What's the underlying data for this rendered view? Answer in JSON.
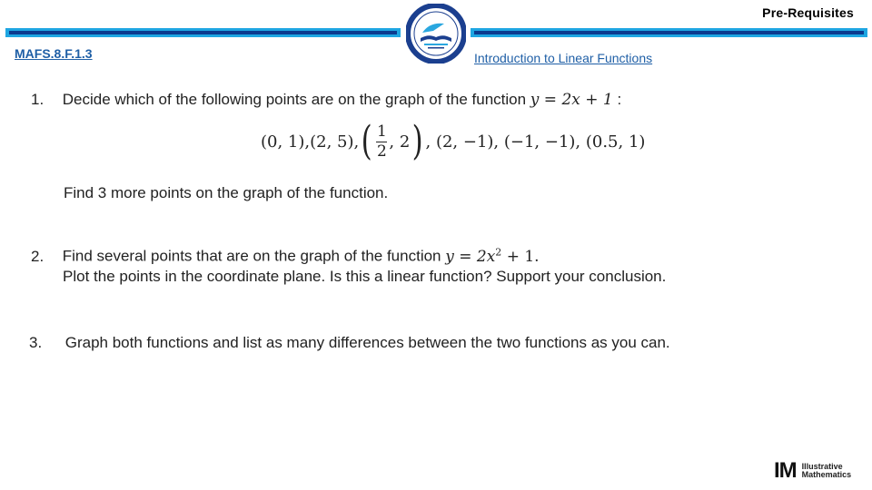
{
  "header": {
    "title": "Pre-Requisites",
    "standard": "MAFS.8.F.1.3",
    "lesson": "Introduction to Linear Functions",
    "colors": {
      "bar_light": "#1ea6e2",
      "bar_dark": "#0b3b8f",
      "link": "#1f5fa6"
    },
    "logo": "school-district-seal-icon"
  },
  "questions": [
    {
      "number": "1.",
      "text": "Decide which of the following points are on the graph of the function",
      "equation": "y = 2x + 1",
      "suffix": ":",
      "points": {
        "p1": "(0, 1),",
        "p2": "(2, 5),",
        "frac_num": "1",
        "frac_den": "2",
        "frac_y": ", 2",
        "p4": ", (2, −1), (−1, −1), (0.5, 1)"
      },
      "followup": "Find 3 more points on the graph of the function."
    },
    {
      "number": "2.",
      "text": "Find several points that are on the graph of the function",
      "equation_base": "y = 2x",
      "equation_exp": "2",
      "equation_tail": " + 1.",
      "followup": "Plot the points in the coordinate plane. Is this a linear function? Support your conclusion."
    },
    {
      "number": "3.",
      "text": "Graph both functions and list as many differences between the two functions as you can."
    }
  ],
  "footer": {
    "brand_mark": "IM",
    "brand_line1": "Illustrative",
    "brand_line2": "Mathematics"
  }
}
